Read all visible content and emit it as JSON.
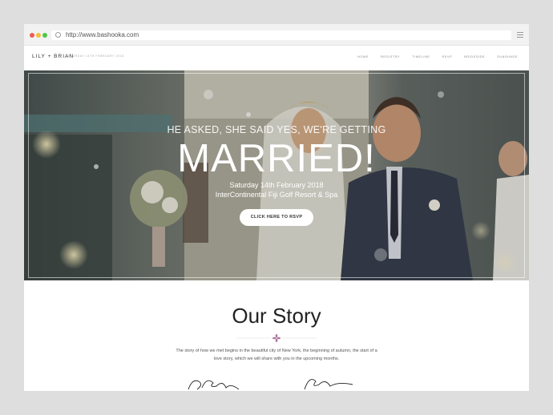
{
  "browser": {
    "url": "http://www.bashooka.com"
  },
  "site": {
    "brand": "LILY + BRIAN",
    "tagline": "SATURDAY 14TH FEBRUARY 2018",
    "nav": [
      {
        "label": "HOME"
      },
      {
        "label": "REGISTRY"
      },
      {
        "label": "TIMELINE"
      },
      {
        "label": "RSVP"
      },
      {
        "label": "BRIDESIDE"
      },
      {
        "label": "SUNSHADE"
      }
    ]
  },
  "hero": {
    "pre_title": "HE ASKED, SHE SAID YES, WE'RE GETTING",
    "title": "MARRIED!",
    "date": "Saturday 14th February 2018",
    "venue": "InterContinental Fiji Golf Resort & Spa",
    "rsvp_button": "CLICK HERE TO RSVP"
  },
  "story": {
    "title": "Our Story",
    "text": "The story of how we met begins in the beautiful city of New York, the beginning of autumn, the start of a love story, which we will share with you in the upcoming months."
  },
  "colors": {
    "ornament": "#b07aa0",
    "page_bg": "#dedede"
  }
}
